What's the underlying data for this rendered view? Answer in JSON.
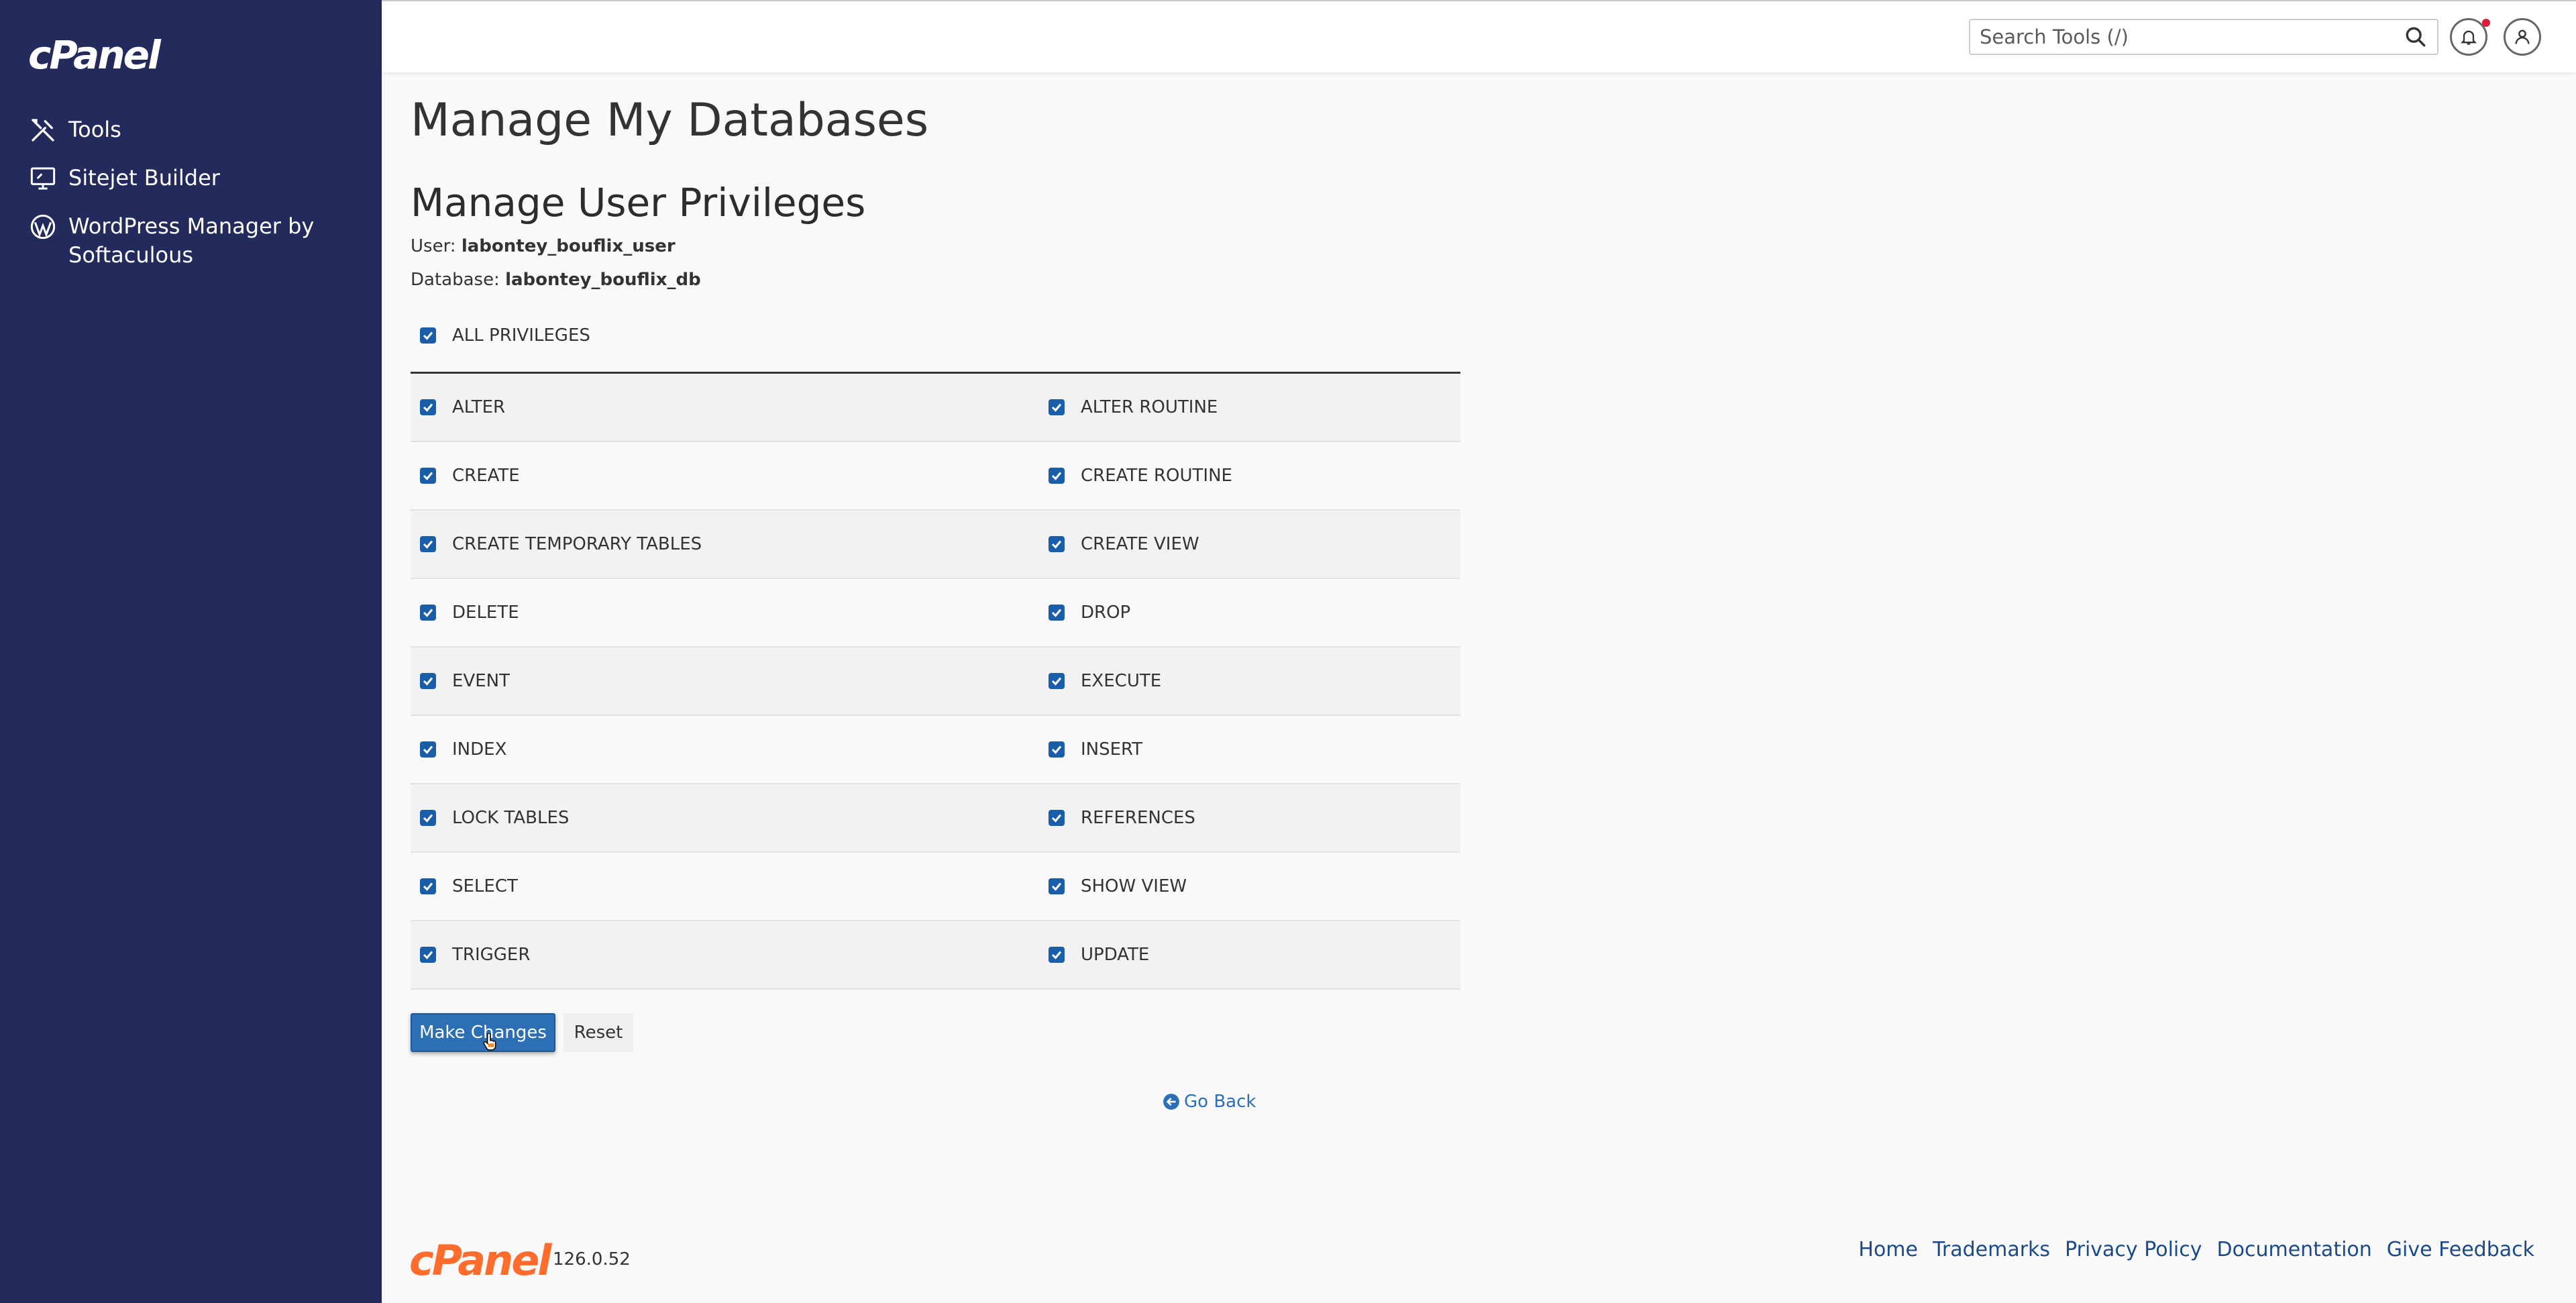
{
  "sidebar": {
    "logo": "cPanel",
    "items": [
      {
        "label": "Tools",
        "icon": "tools-icon"
      },
      {
        "label": "Sitejet Builder",
        "icon": "monitor-icon"
      },
      {
        "label": "WordPress Manager by Softaculous",
        "icon": "wordpress-icon"
      }
    ]
  },
  "header": {
    "search_placeholder": "Search Tools (/)"
  },
  "main": {
    "page_title": "Manage My Databases",
    "section_title": "Manage User Privileges",
    "user_label": "User:",
    "user_value": "labontey_bouflix_user",
    "database_label": "Database:",
    "database_value": "labontey_bouflix_db",
    "all_privileges": "ALL PRIVILEGES",
    "privileges": [
      [
        "ALTER",
        "ALTER ROUTINE"
      ],
      [
        "CREATE",
        "CREATE ROUTINE"
      ],
      [
        "CREATE TEMPORARY TABLES",
        "CREATE VIEW"
      ],
      [
        "DELETE",
        "DROP"
      ],
      [
        "EVENT",
        "EXECUTE"
      ],
      [
        "INDEX",
        "INSERT"
      ],
      [
        "LOCK TABLES",
        "REFERENCES"
      ],
      [
        "SELECT",
        "SHOW VIEW"
      ],
      [
        "TRIGGER",
        "UPDATE"
      ]
    ],
    "make_changes": "Make Changes",
    "reset": "Reset",
    "go_back": "Go Back"
  },
  "footer": {
    "logo": "cPanel",
    "version": "126.0.52",
    "links": [
      "Home",
      "Trademarks",
      "Privacy Policy",
      "Documentation",
      "Give Feedback"
    ]
  },
  "colors": {
    "sidebar": "#232a5c",
    "primary": "#2c6fb5",
    "footer_logo": "#ff6c2c"
  }
}
